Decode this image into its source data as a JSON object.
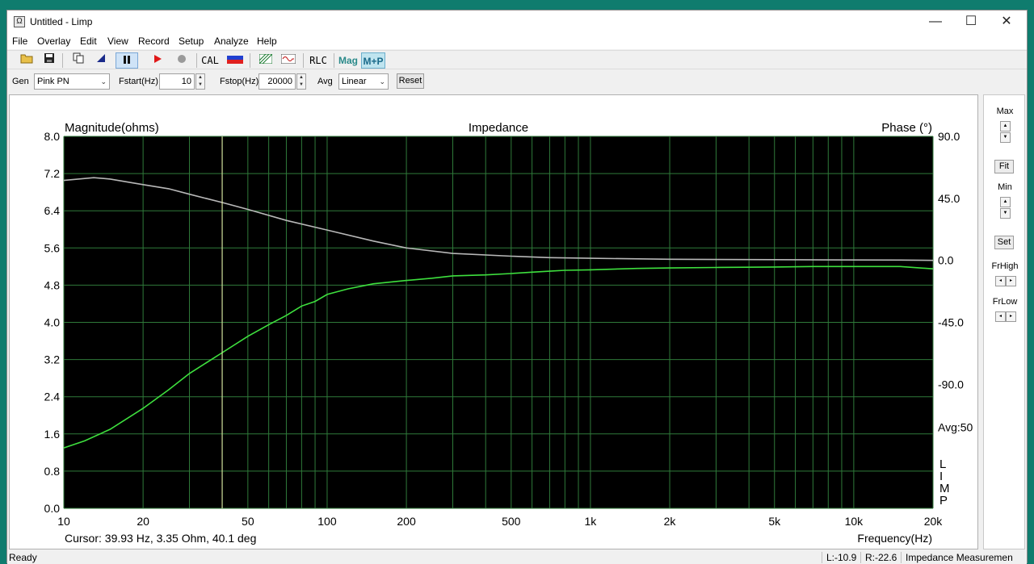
{
  "window": {
    "title": "Untitled - Limp",
    "icon": "omega-icon"
  },
  "window_buttons": {
    "minimize": "—",
    "maximize": "☐",
    "close": "✕"
  },
  "menu": [
    "File",
    "Overlay",
    "Edit",
    "View",
    "Record",
    "Setup",
    "Analyze",
    "Help"
  ],
  "toolbar": {
    "cal": "CAL",
    "rlc": "RLC",
    "mag": "Mag",
    "mp": "M+P"
  },
  "gen": {
    "gen_label": "Gen",
    "gen_value": "Pink PN",
    "fstart_label": "Fstart(Hz)",
    "fstart_value": "10",
    "fstop_label": "Fstop(Hz)",
    "fstop_value": "20000",
    "avg_label": "Avg",
    "avg_value": "Linear",
    "reset": "Reset"
  },
  "side": {
    "max": "Max",
    "fit": "Fit",
    "min": "Min",
    "set": "Set",
    "frhigh": "FrHigh",
    "frlow": "FrLow"
  },
  "status": {
    "ready": "Ready",
    "left": "L:-10.9",
    "right": "R:-22.6",
    "mode": "Impedance Measuremen"
  },
  "chart_data": {
    "type": "line",
    "title": "Impedance",
    "ylabel": "Magnitude(ohms)",
    "y2label": "Phase (°)",
    "xlabel": "Frequency(Hz)",
    "xscale": "log",
    "xlim": [
      10,
      20000
    ],
    "ylim": [
      0,
      8
    ],
    "y2lim": [
      -180,
      90
    ],
    "grid": true,
    "x_tick_labels": [
      "10",
      "20",
      "50",
      "100",
      "200",
      "500",
      "1k",
      "2k",
      "5k",
      "10k",
      "20k"
    ],
    "x_tick_values": [
      10,
      20,
      50,
      100,
      200,
      500,
      1000,
      2000,
      5000,
      10000,
      20000
    ],
    "y_tick_labels": [
      "8.0",
      "7.2",
      "6.4",
      "5.6",
      "4.8",
      "4.0",
      "3.2",
      "2.4",
      "1.6",
      "0.8",
      "0.0"
    ],
    "y_tick_values": [
      8.0,
      7.2,
      6.4,
      5.6,
      4.8,
      4.0,
      3.2,
      2.4,
      1.6,
      0.8,
      0.0
    ],
    "y2_tick_labels": [
      "90.0",
      "45.0",
      "0.0",
      "-45.0",
      "-90.0"
    ],
    "y2_tick_values": [
      90,
      45,
      0,
      -45,
      -90
    ],
    "avg_text": "Avg:50",
    "watermark": "LIMP",
    "cursor": {
      "x": 39.93,
      "text": "Cursor: 39.93 Hz, 3.35 Ohm, 40.1 deg"
    },
    "series": [
      {
        "name": "Magnitude",
        "color": "#3ee03e",
        "axis": "left",
        "x": [
          10,
          12,
          15,
          20,
          25,
          30,
          40,
          50,
          60,
          70,
          80,
          90,
          100,
          120,
          150,
          200,
          250,
          300,
          400,
          500,
          600,
          700,
          800,
          1000,
          1500,
          2000,
          3000,
          5000,
          7000,
          10000,
          15000,
          20000
        ],
        "y": [
          1.3,
          1.45,
          1.7,
          2.15,
          2.55,
          2.9,
          3.35,
          3.7,
          3.95,
          4.15,
          4.35,
          4.45,
          4.6,
          4.72,
          4.83,
          4.9,
          4.95,
          5.0,
          5.02,
          5.05,
          5.08,
          5.1,
          5.12,
          5.13,
          5.16,
          5.17,
          5.18,
          5.19,
          5.2,
          5.2,
          5.2,
          5.15
        ]
      },
      {
        "name": "Phase",
        "color": "#b8b8b8",
        "axis": "right",
        "x": [
          10,
          13,
          15,
          20,
          25,
          30,
          40,
          50,
          70,
          100,
          150,
          200,
          300,
          500,
          700,
          1000,
          2000,
          3000,
          5000,
          10000,
          15000,
          20000
        ],
        "y": [
          58,
          60,
          59,
          55,
          52,
          48,
          42,
          37,
          29,
          22,
          14,
          9,
          5,
          3,
          2,
          1.5,
          0.8,
          0.6,
          0.5,
          0.3,
          0.2,
          0.0
        ]
      }
    ]
  }
}
